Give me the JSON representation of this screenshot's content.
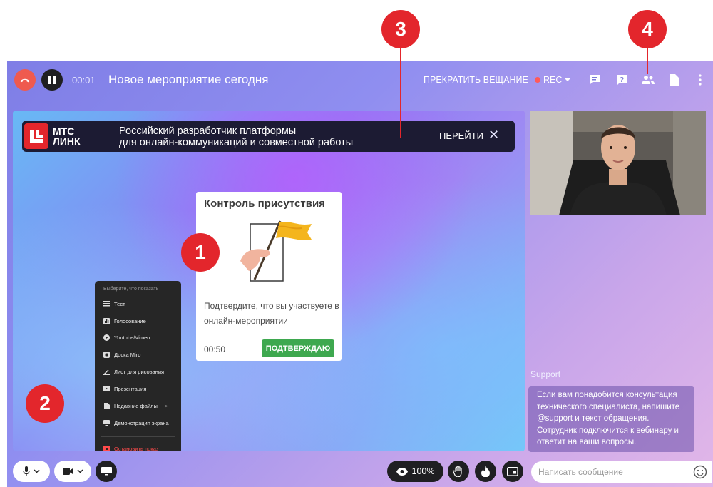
{
  "callouts": [
    "1",
    "2",
    "3",
    "4"
  ],
  "topbar": {
    "timer": "00:01",
    "title": "Новое мероприятие сегодня",
    "stop_stream": "ПРЕКРАТИТЬ ВЕЩАНИЕ",
    "rec": "REC"
  },
  "banner": {
    "logo_line1": "МТС",
    "logo_line2": "ЛИНК",
    "line1": "Российский разработчик платформы",
    "line2": "для онлайн-коммуникаций и совместной работы",
    "go": "ПЕРЕЙТИ",
    "close": "✕"
  },
  "card": {
    "title": "Контроль присутствия",
    "text": "Подтвердите, что вы участвуете в онлайн-мероприятии",
    "timer": "00:50",
    "button": "ПОДТВЕРЖДАЮ"
  },
  "menu": {
    "header": "Выберите, что показать",
    "items": [
      {
        "label": "Тест",
        "icon": "list-icon"
      },
      {
        "label": "Голосование",
        "icon": "poll-icon"
      },
      {
        "label": "Youtube/Vimeo",
        "icon": "youtube-icon"
      },
      {
        "label": "Доска Miro",
        "icon": "board-icon"
      },
      {
        "label": "Лист для рисования",
        "icon": "pencil-icon"
      },
      {
        "label": "Презентация",
        "icon": "presentation-icon"
      },
      {
        "label": "Недавние файлы",
        "icon": "file-icon",
        "arrow": ">"
      },
      {
        "label": "Демонстрация экрана",
        "icon": "screen-icon"
      }
    ],
    "stop": "Остановить показ"
  },
  "chat": {
    "support_label": "Support",
    "support_message": "Если вам понадобится консультация технического специалиста, напишите @support и текст обращения. Сотрудник подключится к вебинару и ответит на ваши вопросы.",
    "input_placeholder": "Написать сообщение"
  },
  "bottombar": {
    "zoom": "100%"
  },
  "colors": {
    "accent_red": "#e3262c",
    "confirm_green": "#3ea84f",
    "dark": "#1f1f22"
  }
}
